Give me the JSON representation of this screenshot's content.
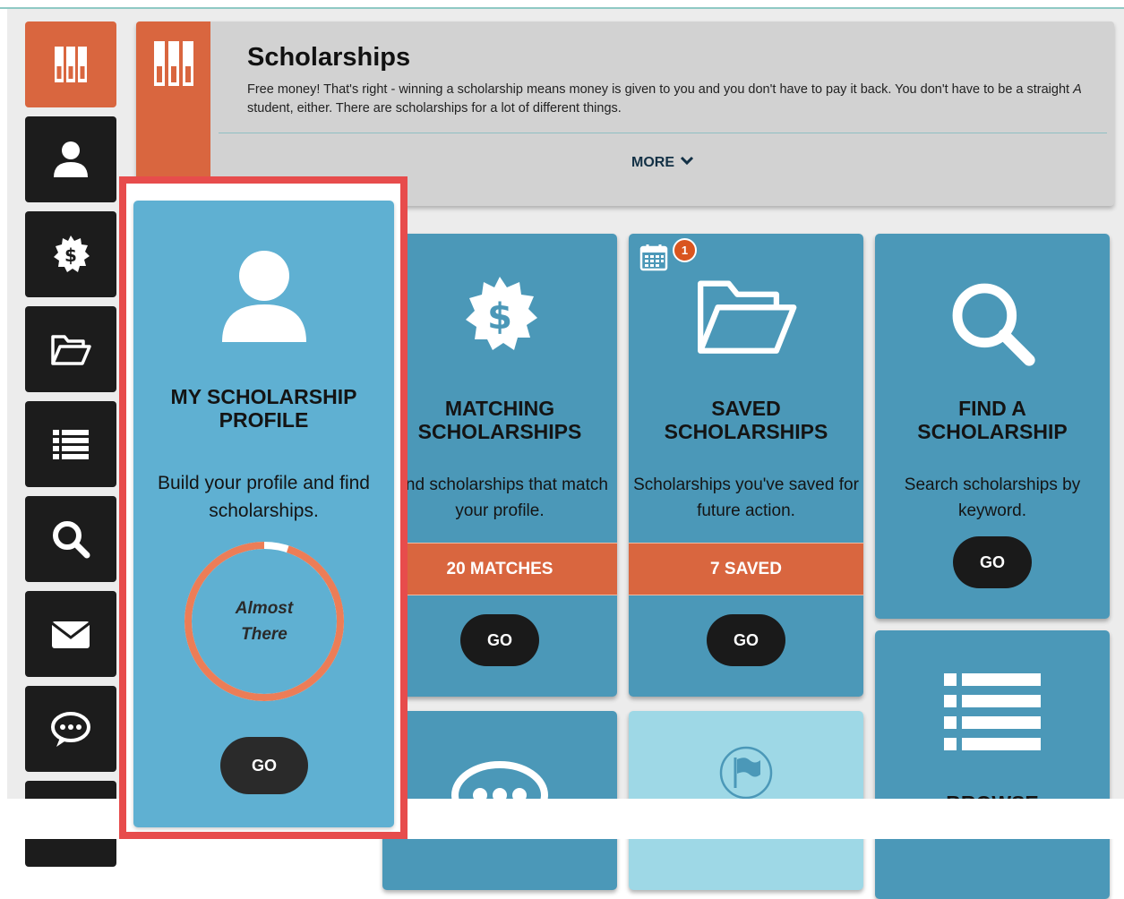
{
  "header": {
    "title": "Scholarships",
    "description_prefix": "Free money! That's right - winning a scholarship means money is given to you and you don't have to pay it back. You don't have to be a straight ",
    "description_emphasis": "A",
    "description_suffix": " student, either. There are scholarships for a lot of different things.",
    "more_label": "MORE"
  },
  "sidebar": {
    "items": [
      {
        "name": "scholarships-home",
        "icon": "books-icon",
        "active": true
      },
      {
        "name": "profile",
        "icon": "user-icon"
      },
      {
        "name": "matching",
        "icon": "dollar-badge-icon"
      },
      {
        "name": "saved",
        "icon": "folder-open-icon"
      },
      {
        "name": "browse",
        "icon": "list-icon"
      },
      {
        "name": "search",
        "icon": "search-icon"
      },
      {
        "name": "messages",
        "icon": "envelope-icon"
      },
      {
        "name": "chat",
        "icon": "chat-bubble-icon"
      }
    ]
  },
  "cards": {
    "profile": {
      "title": "MY SCHOLARSHIP PROFILE",
      "description": "Build your profile and find scholarships.",
      "status_line1": "Almost",
      "status_line2": "There",
      "progress": 0.95,
      "go_label": "GO"
    },
    "matching": {
      "title_line1": "MATCHING",
      "title_line2": "SCHOLARSHIPS",
      "description": "Find scholarships that match your profile.",
      "count_label": "20 MATCHES",
      "go_label": "GO"
    },
    "saved": {
      "title_line1": "SAVED",
      "title_line2": "SCHOLARSHIPS",
      "description": "Scholarships you've saved for future action.",
      "count_label": "7 SAVED",
      "go_label": "GO",
      "calendar_badge": "1"
    },
    "find": {
      "title_line1": "FIND A",
      "title_line2": "SCHOLARSHIP",
      "description": "Search scholarships by keyword.",
      "go_label": "GO"
    },
    "browse": {
      "title_partial": "BROWSE"
    }
  },
  "colors": {
    "accent_orange": "#d9663f",
    "card_blue": "#4b98b8",
    "profile_blue": "#5fb0d2",
    "highlight_red": "#e74c4c",
    "sidebar_dark": "#1c1c1c"
  }
}
